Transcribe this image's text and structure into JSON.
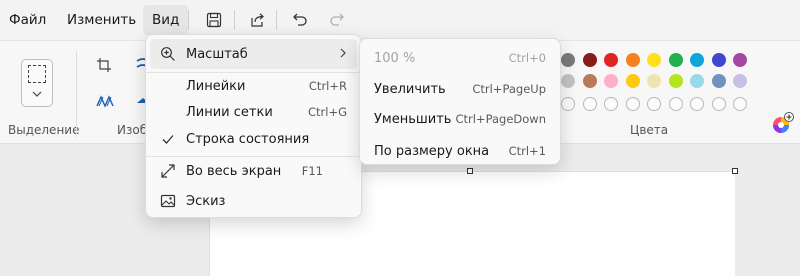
{
  "menubar": {
    "file": "Файл",
    "edit": "Изменить",
    "view": "Вид"
  },
  "ribbon": {
    "selection_label": "Выделение",
    "image_label": "Изобр",
    "colors_label": "Цвета",
    "palette_rows": [
      [
        "#7a7a7a",
        "#8b1a1a",
        "#e02424",
        "#f58220",
        "#ffe01a",
        "#22b14c",
        "#0ea5d8",
        "#3f48cc",
        "#a349a4"
      ],
      [
        "#c3c3c3",
        "#b97a57",
        "#ffaec9",
        "#ffc90e",
        "#efe4b0",
        "#b5e61d",
        "#99d9ea",
        "#7092be",
        "#c8bfe7"
      ]
    ],
    "empty_swatches": 9
  },
  "view_menu": {
    "items": [
      {
        "label": "Масштаб",
        "shortcut": "",
        "icon": "zoom-icon",
        "submenu": true
      },
      {
        "label": "Линейки",
        "shortcut": "Ctrl+R",
        "icon": "",
        "submenu": false
      },
      {
        "label": "Линии сетки",
        "shortcut": "Ctrl+G",
        "icon": "",
        "submenu": false
      },
      {
        "label": "Строка состояния",
        "shortcut": "",
        "icon": "check-icon",
        "submenu": false
      },
      {
        "label": "Во весь экран",
        "shortcut": "F11",
        "icon": "fullscreen-icon",
        "submenu": false
      },
      {
        "label": "Эскиз",
        "shortcut": "",
        "icon": "thumbnail-icon",
        "submenu": false
      }
    ]
  },
  "zoom_submenu": {
    "items": [
      {
        "label": "100 %",
        "shortcut": "Ctrl+0",
        "disabled": true
      },
      {
        "label": "Увеличить",
        "shortcut": "Ctrl+PageUp",
        "disabled": false
      },
      {
        "label": "Уменьшить",
        "shortcut": "Ctrl+PageDown",
        "disabled": false
      },
      {
        "label": "По размеру окна",
        "shortcut": "Ctrl+1",
        "disabled": false
      }
    ]
  }
}
